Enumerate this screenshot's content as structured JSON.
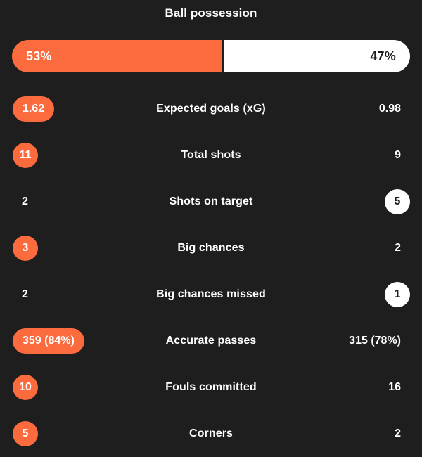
{
  "header": {
    "title": "Ball possession"
  },
  "possession": {
    "home": {
      "label": "53%",
      "percent": 53,
      "color": "#fb6b3e"
    },
    "away": {
      "label": "47%",
      "percent": 47,
      "color": "#ffffff"
    }
  },
  "theme": {
    "background": "#1e1e1e",
    "accent": "#fb6b3e",
    "text": "#ffffff",
    "badge_dark_text": "#1c1c1c"
  },
  "stats": [
    {
      "name": "Expected goals (xG)",
      "home": "1.62",
      "away": "0.98",
      "home_highlight": true,
      "away_highlight": false
    },
    {
      "name": "Total shots",
      "home": "11",
      "away": "9",
      "home_highlight": true,
      "away_highlight": false
    },
    {
      "name": "Shots on target",
      "home": "2",
      "away": "5",
      "home_highlight": false,
      "away_highlight": true
    },
    {
      "name": "Big chances",
      "home": "3",
      "away": "2",
      "home_highlight": true,
      "away_highlight": false
    },
    {
      "name": "Big chances missed",
      "home": "2",
      "away": "1",
      "home_highlight": false,
      "away_highlight": true
    },
    {
      "name": "Accurate passes",
      "home": "359 (84%)",
      "away": "315 (78%)",
      "home_highlight": true,
      "away_highlight": false
    },
    {
      "name": "Fouls committed",
      "home": "10",
      "away": "16",
      "home_highlight": true,
      "away_highlight": false
    },
    {
      "name": "Corners",
      "home": "5",
      "away": "2",
      "home_highlight": true,
      "away_highlight": false
    }
  ]
}
